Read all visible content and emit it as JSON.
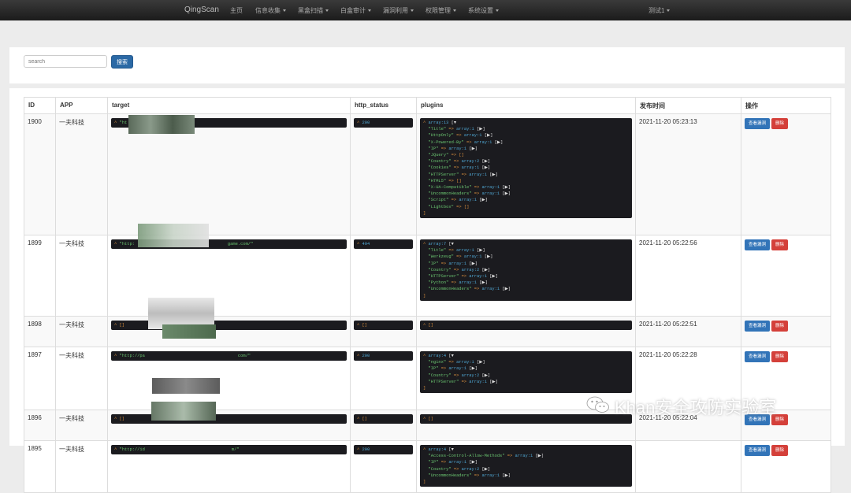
{
  "navbar": {
    "brand": "QingScan",
    "items": [
      {
        "label": "主页",
        "caret": false
      },
      {
        "label": "信息收集",
        "caret": true
      },
      {
        "label": "黑盒扫描",
        "caret": true
      },
      {
        "label": "白盒审计",
        "caret": true
      },
      {
        "label": "漏洞利用",
        "caret": true
      },
      {
        "label": "权限管理",
        "caret": true
      },
      {
        "label": "系统设置",
        "caret": true
      }
    ],
    "user": "测试1"
  },
  "search": {
    "placeholder": "search",
    "button": "搜索"
  },
  "table": {
    "headers": [
      "ID",
      "APP",
      "target",
      "http_status",
      "plugins",
      "发布时间",
      "操作"
    ],
    "view_label": "查看漏洞",
    "delete_label": "删除",
    "rows": [
      {
        "id": "1900",
        "app": "一夫科技",
        "target": "\"ht",
        "status": "200",
        "time": "2021-11-20 05:23:13",
        "plugins": [
          [
            "\"Title\"",
            "array:1"
          ],
          [
            "\"HttpOnly\"",
            "array:1"
          ],
          [
            "\"X-Powered-By\"",
            "array:1"
          ],
          [
            "\"IP\"",
            "array:1"
          ],
          [
            "\"JQuery\"",
            "[]"
          ],
          [
            "\"Country\"",
            "array:2"
          ],
          [
            "\"Cookies\"",
            "array:1"
          ],
          [
            "\"HTTPServer\"",
            "array:1"
          ],
          [
            "\"HTML5\"",
            "[]"
          ],
          [
            "\"X-UA-Compatible\"",
            "array:1"
          ],
          [
            "\"UncommonHeaders\"",
            "array:1"
          ],
          [
            "\"Script\"",
            "array:1"
          ],
          [
            "\"Lightbox\"",
            "[]"
          ]
        ],
        "plugins_count": "13"
      },
      {
        "id": "1899",
        "app": "一夫科技",
        "target": "\"http:",
        "target_tail": "game.com/\"",
        "status": "404",
        "time": "2021-11-20 05:22:56",
        "plugins": [
          [
            "\"Title\"",
            "array:1"
          ],
          [
            "\"Werkzeug\"",
            "array:1"
          ],
          [
            "\"IP\"",
            "array:1"
          ],
          [
            "\"Country\"",
            "array:2"
          ],
          [
            "\"HTTPServer\"",
            "array:1"
          ],
          [
            "\"Python\"",
            "array:1"
          ],
          [
            "\"UncommonHeaders\"",
            "array:1"
          ]
        ],
        "plugins_count": "7"
      },
      {
        "id": "1898",
        "app": "一夫科技",
        "target": "[]",
        "status": "[]",
        "time": "2021-11-20 05:22:51",
        "plugins": [],
        "plugins_empty": "[]"
      },
      {
        "id": "1897",
        "app": "一夫科技",
        "target": "\"http://pa",
        "target_tail": "com/\"",
        "status": "200",
        "time": "2021-11-20 05:22:28",
        "plugins": [
          [
            "\"nginx\"",
            "array:1"
          ],
          [
            "\"IP\"",
            "array:1"
          ],
          [
            "\"Country\"",
            "array:2"
          ],
          [
            "\"HTTPServer\"",
            "array:1"
          ]
        ],
        "plugins_count": "4"
      },
      {
        "id": "1896",
        "app": "一夫科技",
        "target": "[]",
        "status": "[]",
        "time": "2021-11-20 05:22:04",
        "plugins": [],
        "plugins_empty": "[]"
      },
      {
        "id": "1895",
        "app": "一夫科技",
        "target": "\"http://id",
        "target_tail": "m/\"",
        "status": "200",
        "time": "",
        "plugins": [
          [
            "\"Access-Control-Allow-Methods\"",
            "array:1"
          ],
          [
            "\"IP\"",
            "array:1"
          ],
          [
            "\"Country\"",
            "array:2"
          ],
          [
            "\"UncommonHeaders\"",
            "array:1"
          ]
        ],
        "plugins_count": "4"
      }
    ]
  },
  "watermark": "Khan安全攻防实验室"
}
